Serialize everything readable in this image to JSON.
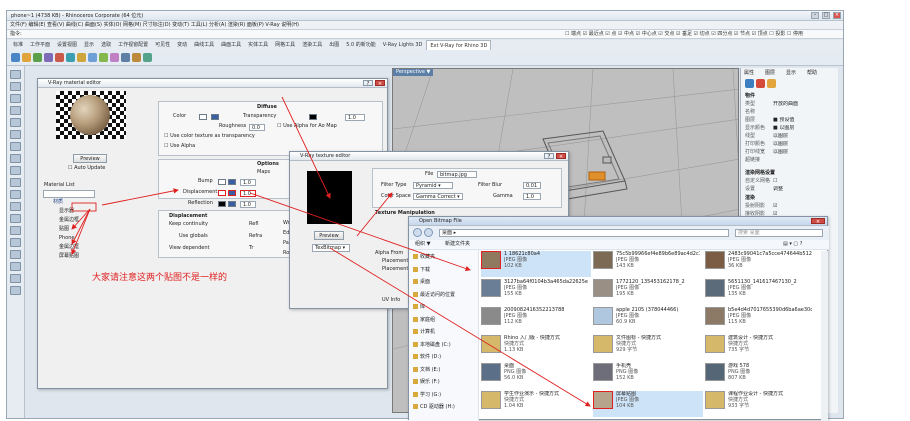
{
  "rhino": {
    "title": "phone~1 (4738 KB) - Rhinoceros Corporate (64 位元)",
    "menu": "文件(F) 编辑(E) 查看(V) 曲线(C) 曲面(S) 实体(O) 网格(M) 尺寸标注(D) 变动(T) 工具(L) 分析(A) 渲染(R) 面板(P) V-Ray 说明(H)",
    "command_prompt": "指令:",
    "osnap": "☐ 端点 ☑ 最近点 ☑ 点 ☑ 中点 ☑ 中心点 ☑ 交点 ☑ 垂足 ☑ 切点 ☑ 四分点 ☑ 节点 ☑ 顶点 ☐ 投影 ☐ 停用",
    "tabs": [
      "标准",
      "工作平面",
      "设置视图",
      "显示",
      "选取",
      "工作视窗配置",
      "可见性",
      "变动",
      "曲线工具",
      "曲面工具",
      "实体工具",
      "网格工具",
      "渲染工具",
      "出图",
      "5.0 的新功能",
      "V-Ray Lights 3D",
      "Ext V-Ray for Rhino 3D"
    ],
    "viewport_label": "Perspective ▼"
  },
  "right_panel": {
    "tabs": [
      "属性",
      "图层",
      "显示",
      "帮助"
    ],
    "heading_object": "物件",
    "rows_object": [
      {
        "k": "类型",
        "v": "开放的曲面"
      },
      {
        "k": "名称",
        "v": ""
      },
      {
        "k": "图层",
        "v": "■ 预设值"
      },
      {
        "k": "显示颜色",
        "v": "■ 以图层"
      },
      {
        "k": "线型",
        "v": "以图层"
      },
      {
        "k": "打印颜色",
        "v": "以图层"
      },
      {
        "k": "打印线宽",
        "v": "以图层"
      },
      {
        "k": "超链接",
        "v": ""
      }
    ],
    "heading_render": "渲染网格设置",
    "rows_render": [
      {
        "k": "自定义网格",
        "v": "☐"
      },
      {
        "k": "设置",
        "v": "调整"
      }
    ],
    "heading_render2": "渲染",
    "rows_render2": [
      {
        "k": "投射阴影",
        "v": "☑"
      },
      {
        "k": "接收阴影",
        "v": "☑"
      }
    ]
  },
  "material_editor": {
    "title": "V-Ray material editor",
    "preview_button": "Preview",
    "auto_update": "Auto Update",
    "material_list_label": "Material List",
    "tree": [
      "材质",
      "显示器",
      "金属边框",
      "贴图",
      "Phone",
      "金属边框",
      "屏幕贴图"
    ],
    "diffuse": {
      "title": "Diffuse",
      "color_label": "Color",
      "transparency_label": "Transparency",
      "transparency_value": "1.0",
      "roughness_label": "Roughness",
      "roughness_value": "0.0",
      "use_color_texture": "Use color texture as transparency",
      "use_alpha": "Use Alpha",
      "use_alpha_map": "Use Alpha for Ao Map"
    },
    "options": {
      "title": "Options",
      "maps_label": "Maps",
      "bump": "Bump",
      "bump_value": "1.0",
      "displacement": "Displacement",
      "displacement_value": "1.0",
      "reflection": "Reflection",
      "reflection_value": "1.0"
    },
    "displacement_section": {
      "title": "Displacement",
      "keep_continuity": "Keep continuity",
      "use_globals": "Use globals",
      "view_dependent": "View dependent",
      "col3": [
        "Refl",
        "Refra",
        "Tr"
      ],
      "col4": [
        "Wr",
        "Ed",
        "Pa",
        "Ro"
      ]
    }
  },
  "texture_editor": {
    "title": "V-Ray texture editor",
    "file_label": "File",
    "file_value": "bitmap.jpg",
    "filter_type_label": "Filter Type",
    "filter_type_value": "Pyramid",
    "filter_blur_label": "Filter Blur",
    "filter_blur_value": "0.01",
    "color_space_label": "Color Space",
    "color_space_value": "Gamma Correct",
    "gamma_label": "Gamma",
    "gamma_value": "1.0",
    "texture_manipulation": "Texture Manipulation",
    "alpha_from": "Alpha From",
    "placement": "Placement",
    "placement2": "Placement",
    "uv_info": "UV Info",
    "preview_button": "Preview",
    "type_select": "TexBitmap"
  },
  "open_dialog": {
    "title": "Open Bitmap File",
    "path": "桌面 ▸",
    "search_placeholder": "搜索 桌面",
    "toolbar": [
      "组织 ▼",
      "新建文件夹"
    ],
    "sidebar": [
      "收藏夹",
      "下载",
      "桌面",
      "最近访问的位置",
      "库",
      "家庭组",
      "计算机",
      "本地磁盘 (C:)",
      "软件 (D:)",
      "文档 (E:)",
      "娱乐 (F:)",
      "学习 (G:)",
      "CD 驱动器 (H:)"
    ],
    "files": [
      {
        "name": "1 18621c80a4",
        "type": "JPEG 图像",
        "size": "102 KB",
        "selected": true
      },
      {
        "name": "3127ba64f0104b3a465da22625e379a0",
        "type": "JPEG 图像",
        "size": "155 KB"
      },
      {
        "name": "2009082416352213788",
        "type": "JPEG 图像",
        "size": "112 KB"
      },
      {
        "name": "Rhino 入门版 - 快捷方式",
        "type": "快捷方式",
        "size": "1.13 KB"
      },
      {
        "name": "桌面",
        "type": "PNG 图像",
        "size": "56.0 KB"
      },
      {
        "name": "学生作业演示 - 快捷方式",
        "type": "快捷方式",
        "size": "1.04 KB"
      },
      {
        "name": "75c5b99966ef4e89b6e89ac4d2c118",
        "type": "JPEG 图像",
        "size": "143 KB"
      },
      {
        "name": "1772120_135453162178_2",
        "type": "JPEG 图像",
        "size": "195 KB"
      },
      {
        "name": "apple 2105 (378044466)",
        "type": "JPEG 图像",
        "size": "60.9 KB"
      },
      {
        "name": "文件图标 - 快捷方式",
        "type": "快捷方式",
        "size": "929 字节"
      },
      {
        "name": "手机壳",
        "type": "PNG 图像",
        "size": "152 KB"
      },
      {
        "name": "屏幕贴图",
        "type": "JPEG 图像",
        "size": "104 KB",
        "selected": true
      },
      {
        "name": "2483c99041c7a5cce474644b51284",
        "type": "JPEG 图像",
        "size": "36 KB"
      },
      {
        "name": "5651130_141617467130_2",
        "type": "JPEG 图像",
        "size": "135 KB"
      },
      {
        "name": "b5e4d4d7017655390d6ba6ae30cea3",
        "type": "JPEG 图像",
        "size": "115 KB"
      },
      {
        "name": "建筑设计 - 快捷方式",
        "type": "快捷方式",
        "size": "735 字节"
      },
      {
        "name": "游戏 578",
        "type": "PNG 图像",
        "size": "807 KB"
      },
      {
        "name": "课程作业设计 - 快捷方式",
        "type": "快捷方式",
        "size": "933 字节"
      }
    ]
  },
  "annotation": "大家请注意这两个贴图不是一样的",
  "colors": {
    "accent_red": "#e02020",
    "viewport_gray": "#bfbfbf",
    "selection_blue": "#cde3f7"
  }
}
